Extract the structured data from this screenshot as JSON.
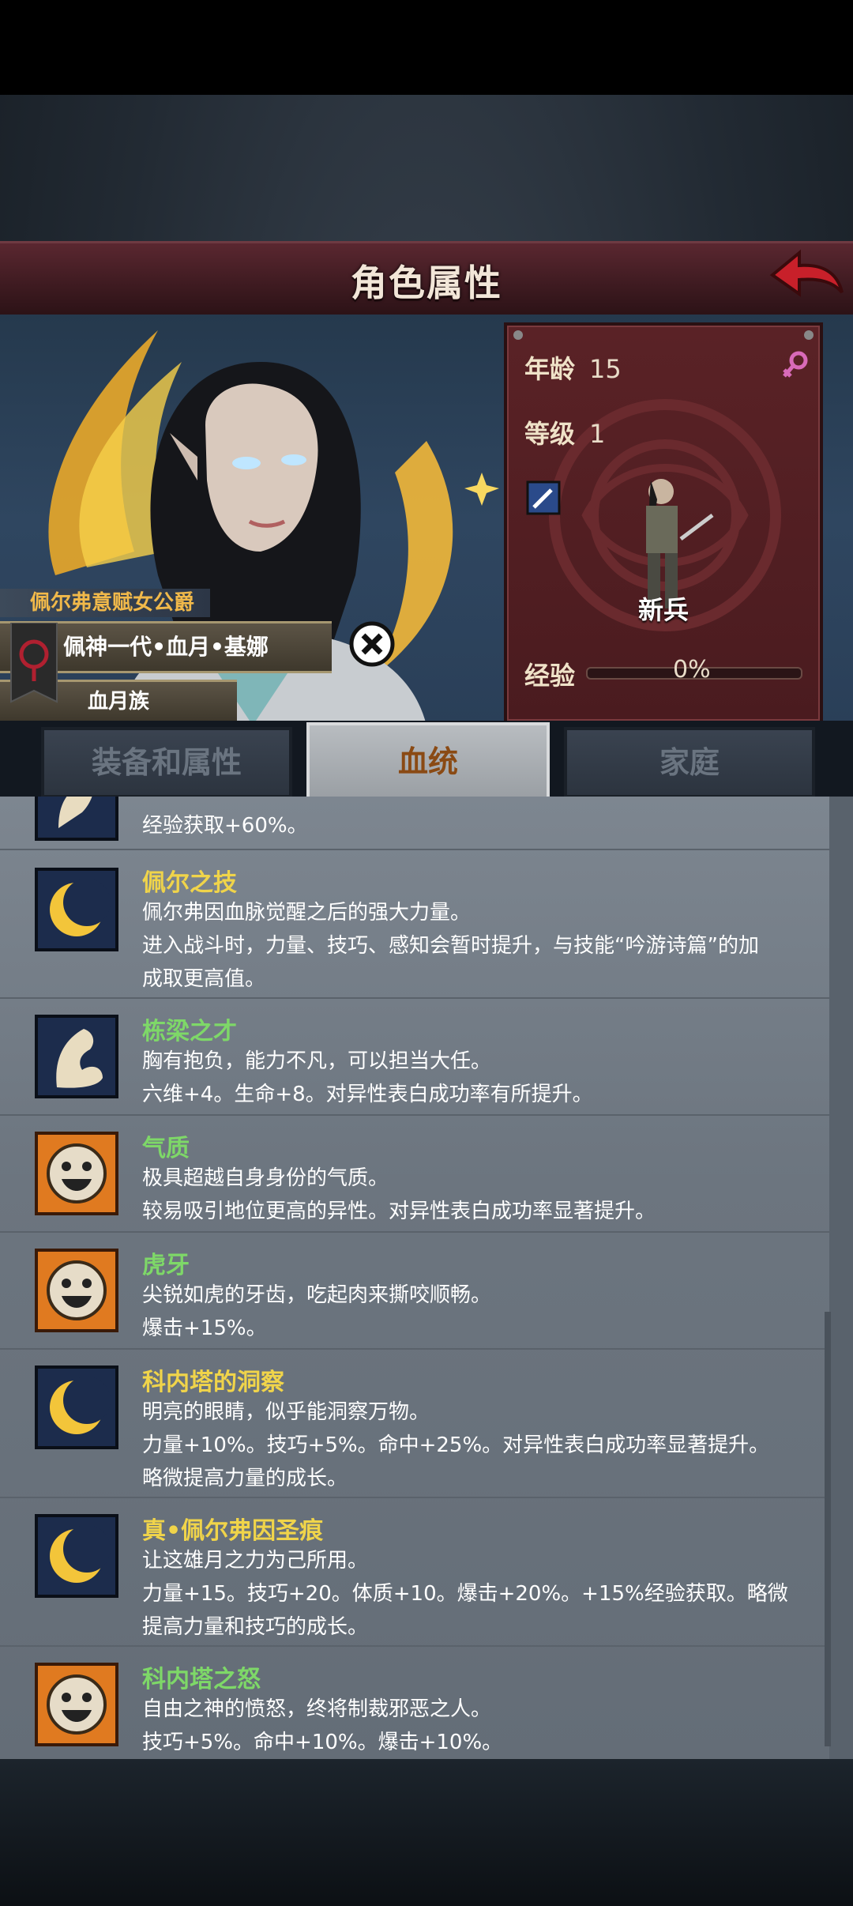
{
  "header": {
    "title": "角色属性"
  },
  "character": {
    "title_banner": "佩尔弗意赋女公爵",
    "name_plate": "佩神一代•血月•基娜",
    "race": "血月族"
  },
  "stats": {
    "age_label": "年龄",
    "age_value": "15",
    "level_label": "等级",
    "level_value": "1",
    "class_name": "新兵",
    "exp_label": "经验",
    "exp_value": "0%",
    "exp_fraction": 0
  },
  "tabs": [
    {
      "label": "装备和属性",
      "active": false
    },
    {
      "label": "血统",
      "active": true
    },
    {
      "label": "家庭",
      "active": false
    }
  ],
  "traits": {
    "t0": {
      "line1": "经验获取+60%。"
    },
    "t1": {
      "name": "佩尔之技",
      "icon": "crescent-moon-icon",
      "line1": "佩尔弗因血脉觉醒之后的强大力量。",
      "line2": "进入战斗时，力量、技巧、感知会暂时提升，与技能“吟游诗篇”的加",
      "line3": "成取更高值。"
    },
    "t2": {
      "name": "栋梁之才",
      "icon": "flexed-arm-icon",
      "line1": "胸有抱负，能力不凡，可以担当大任。",
      "line2": "六维+4。生命+8。对异性表白成功率有所提升。"
    },
    "t3": {
      "name": "气质",
      "icon": "smiling-face-icon",
      "line1": "极具超越自身身份的气质。",
      "line2": "较易吸引地位更高的异性。对异性表白成功率显著提升。"
    },
    "t4": {
      "name": "虎牙",
      "icon": "smiling-face-icon",
      "line1": "尖锐如虎的牙齿，吃起肉来撕咬顺畅。",
      "line2": "爆击+15%。"
    },
    "t5": {
      "name": "科内塔的洞察",
      "icon": "crescent-moon-icon",
      "line1": "明亮的眼睛，似乎能洞察万物。",
      "line2": "力量+10%。技巧+5%。命中+25%。对异性表白成功率显著提升。",
      "line3": "略微提高力量的成长。"
    },
    "t6": {
      "name": "真•佩尔弗因圣痕",
      "icon": "crescent-moon-icon",
      "line1": "让这雄月之力为己所用。",
      "line2": "力量+15。技巧+20。体质+10。爆击+20%。+15%经验获取。略微",
      "line3": "提高力量和技巧的成长。"
    },
    "t7": {
      "name": "科内塔之怒",
      "icon": "smiling-face-icon",
      "line1": "自由之神的愤怒，终将制裁邪恶之人。",
      "line2": "技巧+5%。命中+10%。爆击+10%。"
    }
  },
  "colors": {
    "trait_name_yellow": "#f0d44a",
    "trait_name_green": "#7ed868",
    "header_red": "#4a1c22",
    "active_tab_text": "#8a4a14"
  }
}
